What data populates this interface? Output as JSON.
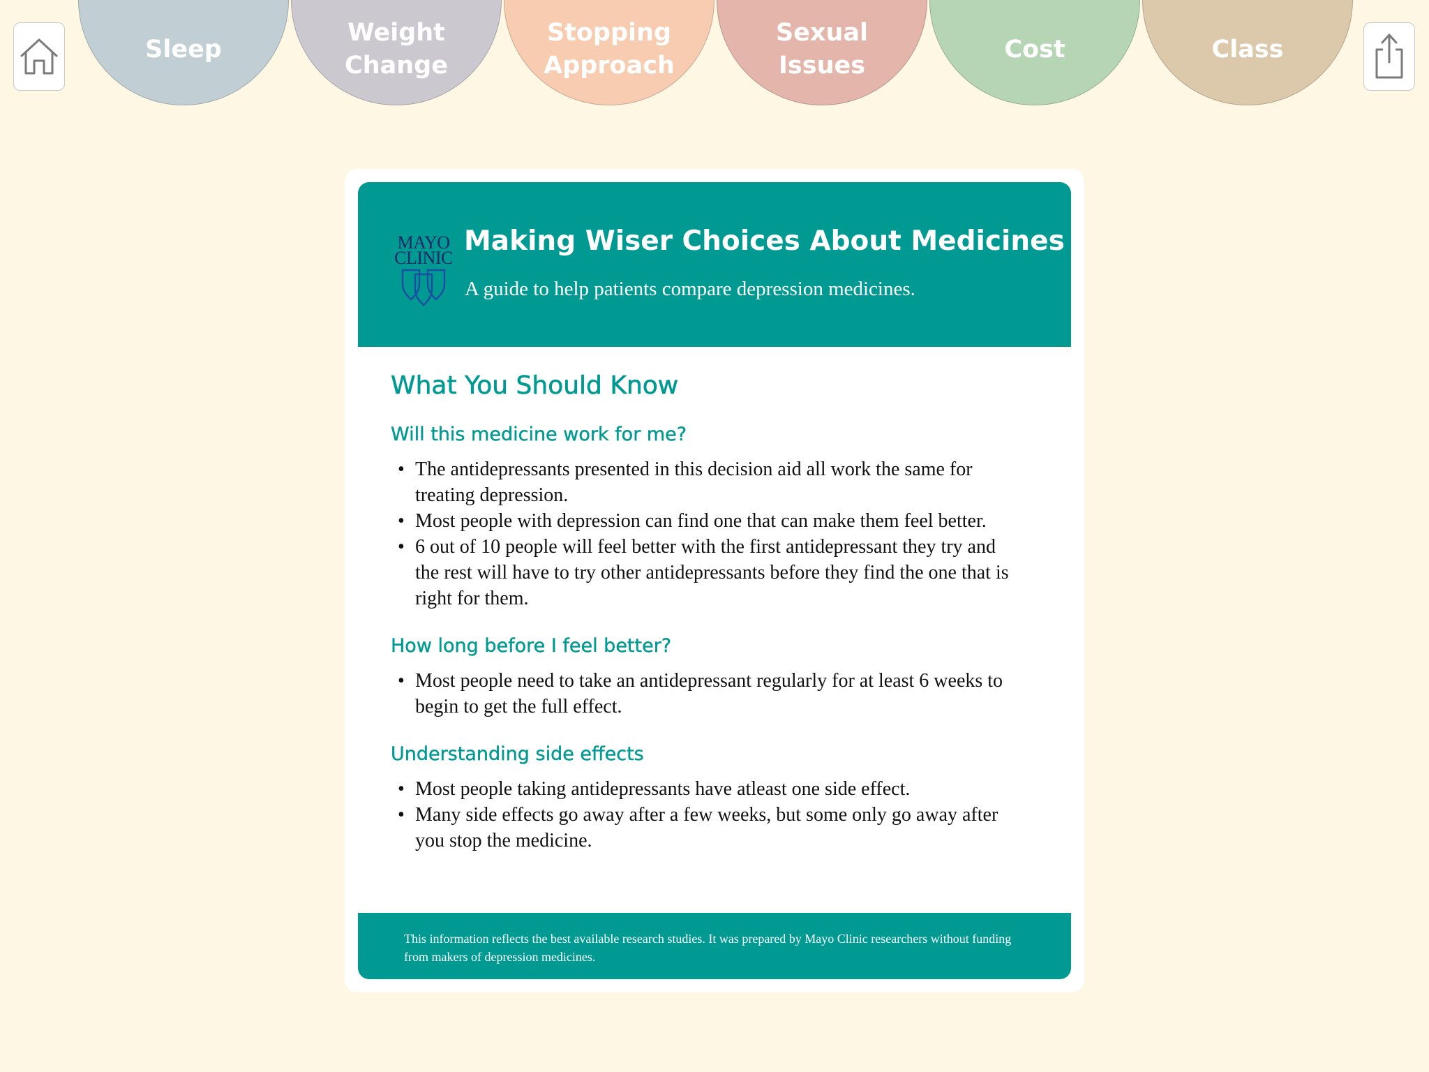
{
  "toolbar": {
    "home_icon": "home-icon",
    "share_icon": "share-icon"
  },
  "tabs": [
    {
      "label": "Sleep",
      "color": "#c1cfd4"
    },
    {
      "label": "Weight\nChange",
      "color": "#cbc8d0"
    },
    {
      "label": "Stopping\nApproach",
      "color": "#f7ccb1"
    },
    {
      "label": "Sexual\nIssues",
      "color": "#e3b5ab"
    },
    {
      "label": "Cost",
      "color": "#b6d5b4"
    },
    {
      "label": "Class",
      "color": "#dcc9ac"
    }
  ],
  "banner": {
    "logo_line1": "MAYO",
    "logo_line2": "CLINIC",
    "title": "Making Wiser Choices About Medicines",
    "subtitle": "A guide to help patients compare depression medicines."
  },
  "main": {
    "heading": "What You Should Know",
    "sections": [
      {
        "heading": "Will this medicine work for me?",
        "bullets": [
          "The antidepressants presented in this decision aid all work the same for treating depression.",
          "Most people with depression can find one that can make them feel better.",
          "6 out of 10 people will feel better with the first antidepressant they try and the rest will have to try other antidepressants before they find the one that is right for them."
        ]
      },
      {
        "heading": "How long before I feel better?",
        "bullets": [
          "Most people need to take an antidepressant regularly for at least 6 weeks to begin to get the full effect."
        ]
      },
      {
        "heading": "Understanding side effects",
        "bullets": [
          "Most people taking antidepressants have atleast one side effect.",
          "Many side effects go away after a few weeks, but some only go away after you stop the medicine."
        ]
      }
    ]
  },
  "footer": {
    "text": "This information reflects the best available research studies. It was prepared by Mayo Clinic researchers without funding from makers of depression medicines."
  },
  "colors": {
    "background": "#fef7e3",
    "accent": "#019a93"
  }
}
